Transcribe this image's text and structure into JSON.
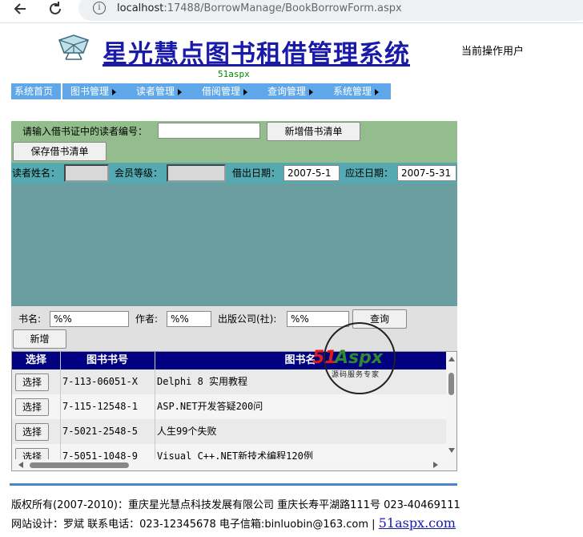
{
  "browser": {
    "url_host": "localhost",
    "url_path": ":17488/BorrowManage/BookBorrowForm.aspx"
  },
  "header": {
    "title": "星光慧点图书租借管理系统",
    "sub_brand": "51aspx",
    "current_user_label": "当前操作用户"
  },
  "menu": {
    "items": [
      {
        "label": "系统首页",
        "arrow": false
      },
      {
        "label": "图书管理",
        "arrow": true
      },
      {
        "label": "读者管理",
        "arrow": true
      },
      {
        "label": "借阅管理",
        "arrow": true
      },
      {
        "label": "查询管理",
        "arrow": true
      },
      {
        "label": "系统管理",
        "arrow": true
      }
    ]
  },
  "borrow": {
    "reader_id_label": "请输入借书证中的读者编号：",
    "reader_id_value": "",
    "new_list_button": "新增借书清单",
    "save_list_button": "保存借书清单",
    "reader_name_label": "读者姓名：",
    "member_level_label": "会员等级：",
    "borrow_date_label": "借出日期：",
    "borrow_date_value": "2007-5-1",
    "due_date_label": "应还日期：",
    "due_date_value": "2007-5-31"
  },
  "search": {
    "book_name_label": "书名:",
    "book_name_value": "%%",
    "author_label": "作者:",
    "author_value": "%%",
    "publisher_label": "出版公司(社):",
    "publisher_value": "%%",
    "query_button": "查询",
    "add_button": "新增"
  },
  "grid": {
    "columns": [
      "选择",
      "图书书号",
      "图书名"
    ],
    "select_label": "选择",
    "rows": [
      {
        "isbn": "7-113-06051-X",
        "title": "Delphi 8 实用教程"
      },
      {
        "isbn": "7-115-12548-1",
        "title": "ASP.NET开发答疑200问"
      },
      {
        "isbn": "7-5021-2548-5",
        "title": "人生99个失败"
      },
      {
        "isbn": "7-5051-1048-9",
        "title": "Visual C++.NET新技术编程120例"
      }
    ]
  },
  "watermark": {
    "brand_red": "51",
    "brand_green": "Aspx",
    "tagline": "源码服务专家"
  },
  "footer": {
    "line1": "版权所有(2007-2010)：重庆星光慧点科技发展有限公司 重庆长寿平湖路111号 023-40469111",
    "line2_prefix": "网站设计：罗斌   联系电话：023-12345678 电子信箱:binluobin@163.com |",
    "link": "51aspx.com"
  },
  "colors": {
    "title_blue": "#1a1aa8",
    "menu_bg": "#5fa7e8",
    "green_panel": "#93bd8c",
    "teal_row": "#54aab0",
    "teal_body": "#6a9ea0",
    "grid_header": "#000080",
    "footer_line": "#4a86c8"
  }
}
